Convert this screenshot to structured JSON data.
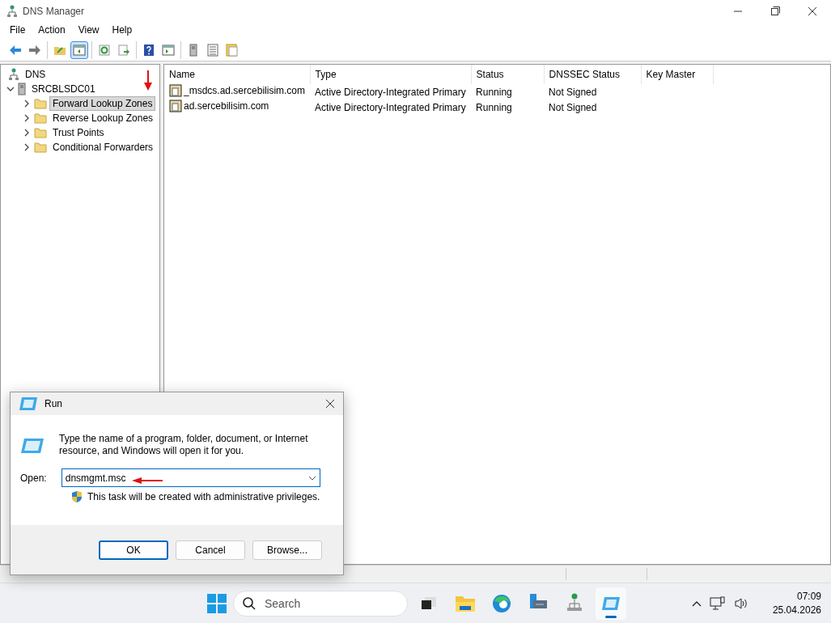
{
  "window": {
    "title": "DNS Manager"
  },
  "menu": [
    "File",
    "Action",
    "View",
    "Help"
  ],
  "toolbar": [
    [
      {
        "kind": "back",
        "selected": false
      },
      {
        "kind": "forward",
        "selected": false
      }
    ],
    [
      {
        "kind": "up",
        "selected": false
      },
      {
        "kind": "console-tree",
        "selected": true
      }
    ],
    [
      {
        "kind": "refresh",
        "selected": false
      },
      {
        "kind": "export",
        "selected": false
      }
    ],
    [
      {
        "kind": "help",
        "selected": false
      },
      {
        "kind": "action-pane",
        "selected": false
      }
    ],
    [
      {
        "kind": "server",
        "selected": false
      },
      {
        "kind": "list",
        "selected": false
      },
      {
        "kind": "properties",
        "selected": false
      }
    ]
  ],
  "tree": [
    {
      "label": "DNS",
      "kind": "dns",
      "selected": false,
      "children": [
        {
          "label": "SRCBLSDC01",
          "kind": "server",
          "selected": false,
          "expanded": true,
          "children": [
            {
              "label": "Forward Lookup Zones",
              "kind": "folder",
              "selected": true,
              "expanded": false
            },
            {
              "label": "Reverse Lookup Zones",
              "kind": "folder",
              "selected": false,
              "expanded": false
            },
            {
              "label": "Trust Points",
              "kind": "folder",
              "selected": false,
              "expanded": false
            },
            {
              "label": "Conditional Forwarders",
              "kind": "folder",
              "selected": false,
              "expanded": false
            }
          ]
        }
      ]
    }
  ],
  "table": {
    "columns": [
      "Name",
      "Type",
      "Status",
      "DNSSEC Status",
      "Key Master"
    ],
    "rows": [
      [
        "_msdcs.ad.sercebilisim.com",
        "Active Directory-Integrated Primary",
        "Running",
        "Not Signed",
        ""
      ],
      [
        "ad.sercebilisim.com",
        "Active Directory-Integrated Primary",
        "Running",
        "Not Signed",
        ""
      ]
    ]
  },
  "run_dialog": {
    "title": "Run",
    "message": "Type the name of a program, folder, document, or Internet resource, and Windows will open it for you.",
    "open_label": "Open:",
    "value": "dnsmgmt.msc",
    "note": "This task will be created with administrative privileges.",
    "buttons": [
      {
        "label": "OK",
        "default": true
      },
      {
        "label": "Cancel",
        "default": false
      },
      {
        "label": "Browse...",
        "default": false
      }
    ]
  },
  "taskbar": {
    "search": {
      "placeholder": "Search"
    },
    "apps": [
      {
        "kind": "task-view",
        "active": false
      },
      {
        "kind": "explorer",
        "active": false
      },
      {
        "kind": "edge",
        "active": false
      },
      {
        "kind": "server-manager",
        "active": false
      },
      {
        "kind": "dns",
        "active": false
      },
      {
        "kind": "run",
        "active": true
      }
    ],
    "time": "07:09",
    "date": "25.04.2026"
  }
}
